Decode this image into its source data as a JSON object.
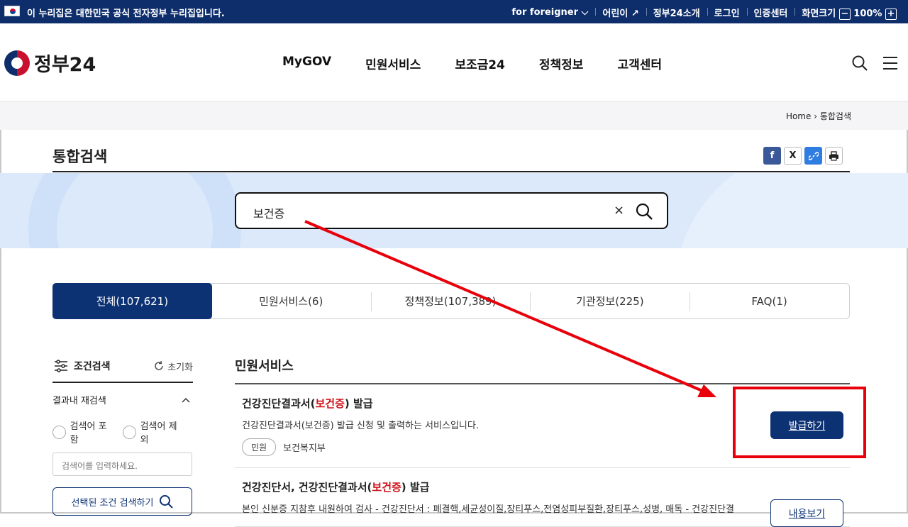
{
  "gov_bar": {
    "message": "이 누리집은 대한민국 공식 전자정부 누리집입니다.",
    "links": [
      "for foreigner",
      "어린이",
      "정부24소개",
      "로그인",
      "인증센터",
      "화면크기"
    ],
    "zoom": "100%",
    "zoom_minus": "−",
    "zoom_plus": "+"
  },
  "header": {
    "logo_text": "정부24",
    "nav": [
      "MyGOV",
      "민원서비스",
      "보조금24",
      "정책정보",
      "고객센터"
    ]
  },
  "breadcrumb": {
    "home": "Home",
    "current": "통합검색"
  },
  "page_title": "통합검색",
  "share": {
    "facebook": "f",
    "x": "X"
  },
  "search": {
    "value": "보건증",
    "clear": "×"
  },
  "tabs": [
    "전체(107,621)",
    "민원서비스(6)",
    "정책정보(107,389)",
    "기관정보(225)",
    "FAQ(1)"
  ],
  "sidebar": {
    "title": "조건검색",
    "reset": "초기화",
    "refine": "결과내 재검색",
    "include": "검색어 포함",
    "exclude": "검색어 제외",
    "placeholder": "검색어를 입력하세요.",
    "button": "선택된 조건 검색하기"
  },
  "results": {
    "section": "민원서비스",
    "items": [
      {
        "title_pre": "건강진단결과서(",
        "title_hl": "보건증",
        "title_post": ") 발급",
        "desc": "건강진단결과서(보건증) 발급 신청 및 출력하는 서비스입니다.",
        "badge": "민원",
        "org": "보건복지부",
        "action": "발급하기"
      },
      {
        "title_pre": "건강진단서, 건강진단결과서(",
        "title_hl": "보건증",
        "title_post": ") 발급",
        "desc": "본인 신분증 지참후 내원하여 검사 - 건강진단서 : 폐결핵,세균성이질,장티푸스,전염성피부질환,장티푸스,성병, 매독 - 건강진단결",
        "action": "내용보기"
      }
    ]
  },
  "colors": {
    "navy": "#0d3274",
    "highlight": "#d0121b",
    "annotation": "#e8000b"
  }
}
